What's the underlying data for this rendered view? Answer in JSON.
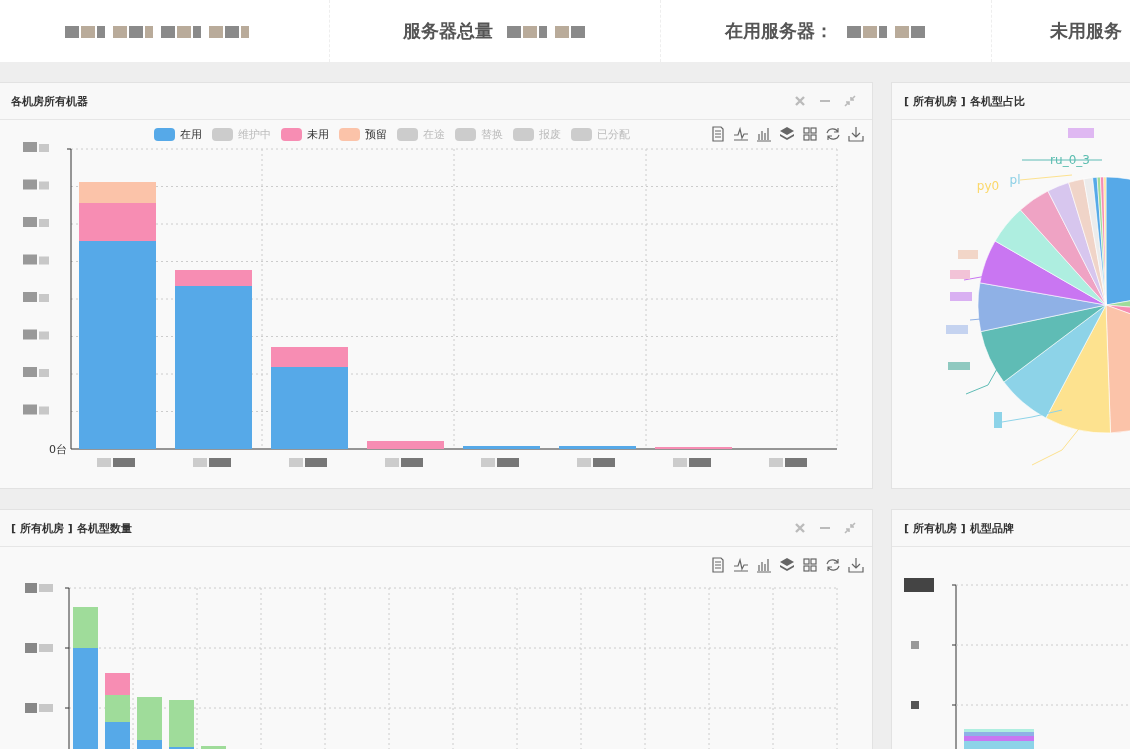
{
  "stats": [
    {
      "kind": "redacted"
    },
    {
      "kind": "labeled",
      "label": "服务器总量"
    },
    {
      "kind": "labeled",
      "label": "在用服务器："
    },
    {
      "kind": "labeled",
      "label": "未用服务"
    }
  ],
  "panels": [
    {
      "title": "各机房所有机器",
      "kind": "machine_bar",
      "window_controls": true,
      "toolbox": true,
      "y_zero_label": "0台",
      "legend": [
        {
          "label": "在用",
          "on": true,
          "color": "#56a9e8"
        },
        {
          "label": "维护中",
          "on": false
        },
        {
          "label": "未用",
          "on": true,
          "color": "#f78db3"
        },
        {
          "label": "预留",
          "on": true,
          "color": "#fbc3a9"
        },
        {
          "label": "在途",
          "on": false
        },
        {
          "label": "替换",
          "on": false
        },
        {
          "label": "报废",
          "on": false
        },
        {
          "label": "已分配",
          "on": false
        }
      ]
    },
    {
      "title": "[ 所有机房 ] 各机型占比",
      "kind": "pie",
      "window_controls": false,
      "toolbox": false,
      "pie_labels": [
        {
          "label": "ru_0_3",
          "color": "#5cbdb0"
        },
        {
          "label": "pl",
          "color": "#8dd0e6"
        },
        {
          "label": "py0",
          "color": "#fbd86a"
        }
      ]
    },
    {
      "title": "[ 所有机房 ] 各机型数量",
      "kind": "model_bar",
      "window_controls": true,
      "toolbox": true
    },
    {
      "title": "[ 所有机房 ] 机型品牌",
      "kind": "brand_bar",
      "window_controls": false,
      "toolbox": false
    }
  ]
}
